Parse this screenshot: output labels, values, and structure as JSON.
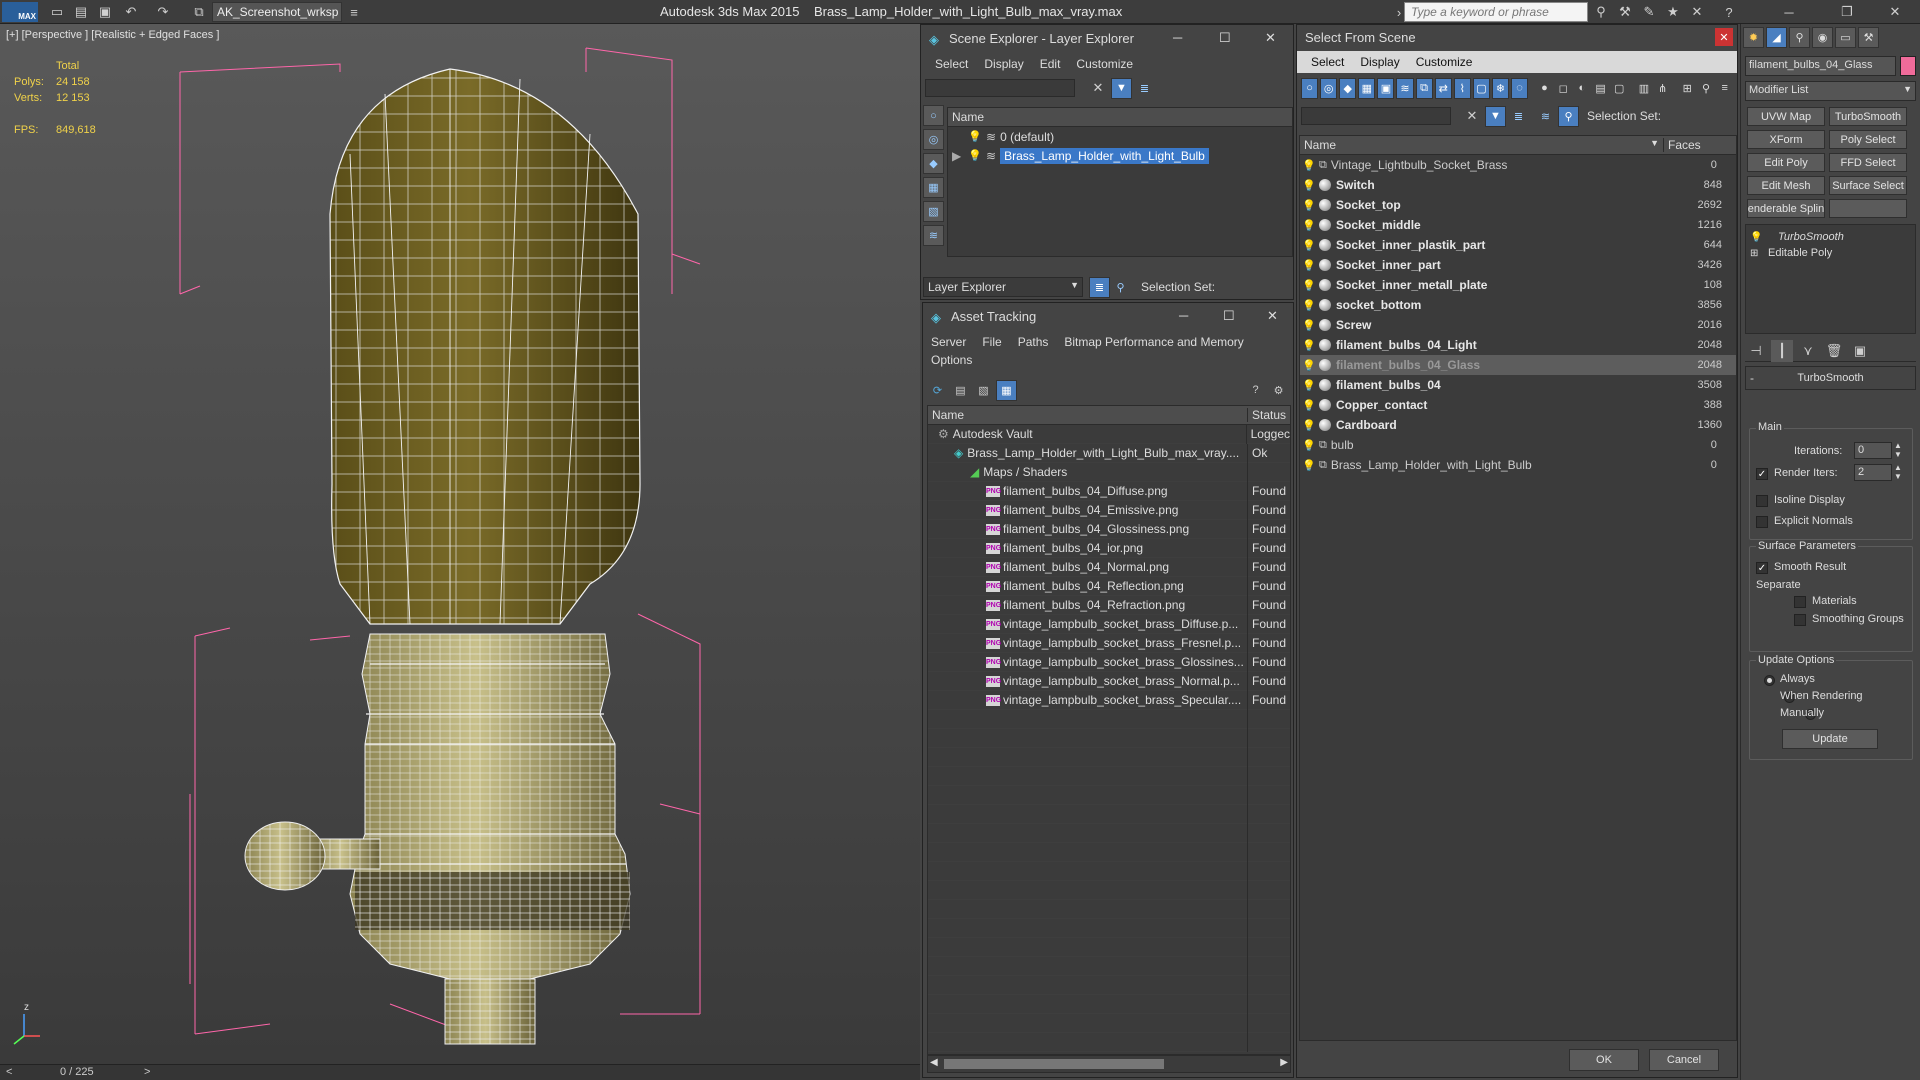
{
  "app": {
    "logo": "MAX",
    "workspace": "AK_Screenshot_wrksp",
    "title_app": "Autodesk 3ds Max  2015",
    "title_file": "Brass_Lamp_Holder_with_Light_Bulb_max_vray.max",
    "search_placeholder": "Type a keyword or phrase"
  },
  "viewport": {
    "label": "[+] [Perspective ] [Realistic + Edged Faces ]",
    "stats": {
      "total_label": "Total",
      "polys_label": "Polys:",
      "polys": "24 158",
      "verts_label": "Verts:",
      "verts": "12 153",
      "fps_label": "FPS:",
      "fps": "849,618"
    },
    "axis_z": "z"
  },
  "status": {
    "frame": "0 / 225",
    "prev": "<",
    "next": ">"
  },
  "scene_explorer": {
    "title": "Scene Explorer - Layer Explorer",
    "menu": [
      "Select",
      "Display",
      "Edit",
      "Customize"
    ],
    "col_name": "Name",
    "layers": [
      "0 (default)",
      "Brass_Lamp_Holder_with_Light_Bulb"
    ],
    "footer_dropdown": "Layer Explorer",
    "selection_set": "Selection Set:"
  },
  "asset_tracking": {
    "title": "Asset Tracking",
    "menu": [
      "Server",
      "File",
      "Paths",
      "Bitmap Performance and Memory"
    ],
    "menu2": "Options",
    "col_name": "Name",
    "col_status": "Status",
    "rows": [
      {
        "name": "Autodesk Vault",
        "status": "Loggec",
        "indent": 0,
        "icon": "vault"
      },
      {
        "name": "Brass_Lamp_Holder_with_Light_Bulb_max_vray....",
        "status": "Ok",
        "indent": 1,
        "icon": "max"
      },
      {
        "name": "Maps / Shaders",
        "status": "",
        "indent": 2,
        "icon": "maps"
      },
      {
        "name": "filament_bulbs_04_Diffuse.png",
        "status": "Found",
        "indent": 3,
        "icon": "png"
      },
      {
        "name": "filament_bulbs_04_Emissive.png",
        "status": "Found",
        "indent": 3,
        "icon": "png"
      },
      {
        "name": "filament_bulbs_04_Glossiness.png",
        "status": "Found",
        "indent": 3,
        "icon": "png"
      },
      {
        "name": "filament_bulbs_04_ior.png",
        "status": "Found",
        "indent": 3,
        "icon": "png"
      },
      {
        "name": "filament_bulbs_04_Normal.png",
        "status": "Found",
        "indent": 3,
        "icon": "png"
      },
      {
        "name": "filament_bulbs_04_Reflection.png",
        "status": "Found",
        "indent": 3,
        "icon": "png"
      },
      {
        "name": "filament_bulbs_04_Refraction.png",
        "status": "Found",
        "indent": 3,
        "icon": "png"
      },
      {
        "name": "vintage_lampbulb_socket_brass_Diffuse.p...",
        "status": "Found",
        "indent": 3,
        "icon": "png"
      },
      {
        "name": "vintage_lampbulb_socket_brass_Fresnel.p...",
        "status": "Found",
        "indent": 3,
        "icon": "png"
      },
      {
        "name": "vintage_lampbulb_socket_brass_Glossines...",
        "status": "Found",
        "indent": 3,
        "icon": "png"
      },
      {
        "name": "vintage_lampbulb_socket_brass_Normal.p...",
        "status": "Found",
        "indent": 3,
        "icon": "png"
      },
      {
        "name": "vintage_lampbulb_socket_brass_Specular....",
        "status": "Found",
        "indent": 3,
        "icon": "png"
      }
    ]
  },
  "select_from_scene": {
    "title": "Select From Scene",
    "menu": [
      "Select",
      "Display",
      "Customize"
    ],
    "selection_set": "Selection Set:",
    "col_name": "Name",
    "col_faces": "Faces",
    "rows": [
      {
        "name": "Vintage_Lightbulb_Socket_Brass",
        "faces": "0",
        "bold": false,
        "type": "group"
      },
      {
        "name": "Switch",
        "faces": "848",
        "bold": true,
        "type": "mesh"
      },
      {
        "name": "Socket_top",
        "faces": "2692",
        "bold": true,
        "type": "mesh"
      },
      {
        "name": "Socket_middle",
        "faces": "1216",
        "bold": true,
        "type": "mesh"
      },
      {
        "name": "Socket_inner_plastik_part",
        "faces": "644",
        "bold": true,
        "type": "mesh"
      },
      {
        "name": "Socket_inner_part",
        "faces": "3426",
        "bold": true,
        "type": "mesh"
      },
      {
        "name": "Socket_inner_metall_plate",
        "faces": "108",
        "bold": true,
        "type": "mesh"
      },
      {
        "name": "socket_bottom",
        "faces": "3856",
        "bold": true,
        "type": "mesh"
      },
      {
        "name": "Screw",
        "faces": "2016",
        "bold": true,
        "type": "mesh"
      },
      {
        "name": "filament_bulbs_04_Light",
        "faces": "2048",
        "bold": true,
        "type": "mesh"
      },
      {
        "name": "filament_bulbs_04_Glass",
        "faces": "2048",
        "bold": true,
        "type": "mesh",
        "selected": true
      },
      {
        "name": "filament_bulbs_04",
        "faces": "3508",
        "bold": true,
        "type": "mesh"
      },
      {
        "name": "Copper_contact",
        "faces": "388",
        "bold": true,
        "type": "mesh"
      },
      {
        "name": "Cardboard",
        "faces": "1360",
        "bold": true,
        "type": "mesh"
      },
      {
        "name": "bulb",
        "faces": "0",
        "bold": false,
        "type": "group"
      },
      {
        "name": "Brass_Lamp_Holder_with_Light_Bulb",
        "faces": "0",
        "bold": false,
        "type": "group"
      }
    ],
    "ok": "OK",
    "cancel": "Cancel"
  },
  "command_panel": {
    "object_name": "filament_bulbs_04_Glass",
    "modifier_list": "Modifier List",
    "buttons": [
      [
        "UVW Map",
        "TurboSmooth"
      ],
      [
        "XForm",
        "Poly Select"
      ],
      [
        "Edit Poly",
        "FFD Select"
      ],
      [
        "Edit Mesh",
        "Surface Select"
      ],
      [
        "enderable Splin",
        ""
      ]
    ],
    "stack": [
      "TurboSmooth",
      "Editable Poly"
    ],
    "rollout_title": "TurboSmooth",
    "main_label": "Main",
    "iterations_label": "Iterations:",
    "iterations": "0",
    "render_iters_label": "Render Iters:",
    "render_iters": "2",
    "isoline": "Isoline Display",
    "explicit_normals": "Explicit Normals",
    "surface_params": "Surface Parameters",
    "smooth_result": "Smooth Result",
    "separate": "Separate",
    "materials": "Materials",
    "smoothing_groups": "Smoothing Groups",
    "update_options": "Update Options",
    "always": "Always",
    "when_rendering": "When Rendering",
    "manually": "Manually",
    "update_btn": "Update",
    "collapse": "-"
  },
  "colors": {
    "accent": "#3a78c8",
    "mesh_fill": "#6f6422",
    "wire": "#ffffff",
    "bbox": "#ff66aa"
  }
}
